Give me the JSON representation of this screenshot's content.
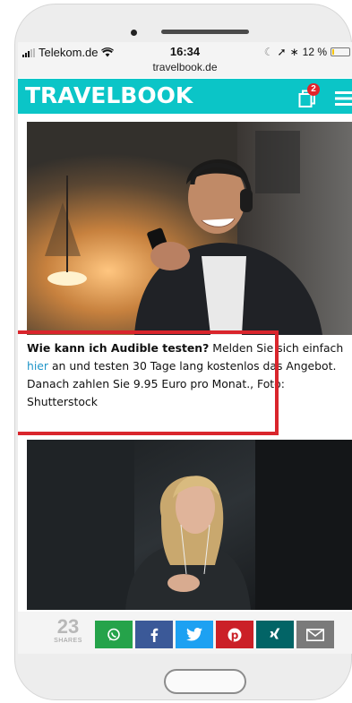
{
  "status_bar": {
    "carrier": "Telekom.de",
    "time": "16:34",
    "url": "travelbook.de",
    "battery": "12 %",
    "battery_level": 0.12
  },
  "header": {
    "logo": "TRAVELBOOK",
    "badge_count": "2"
  },
  "photos": [
    {
      "name": "man-with-headphones-photo"
    },
    {
      "name": "woman-with-earphones-photo"
    }
  ],
  "caption": {
    "bold": "Wie kann ich Audible testen?",
    "text1": " Melden Sie sich einfach ",
    "link": "hier",
    "text2": " an und testen 30 Tage lang kostenlos das Angebot. Danach zahlen Sie 9.95 Euro pro Monat., Foto: Shutterstock"
  },
  "share": {
    "count": "23",
    "count_label": "SHARES",
    "buttons": [
      {
        "name": "whatsapp",
        "color": "#25a34a"
      },
      {
        "name": "facebook",
        "color": "#3b5998"
      },
      {
        "name": "twitter",
        "color": "#1da1f2"
      },
      {
        "name": "pinterest",
        "color": "#cb2027"
      },
      {
        "name": "xing",
        "color": "#026466"
      },
      {
        "name": "email",
        "color": "#7a7a7a"
      }
    ]
  },
  "colors": {
    "header_bg": "#0bc5c7",
    "highlight": "#d9252c",
    "link": "#2196c9"
  }
}
